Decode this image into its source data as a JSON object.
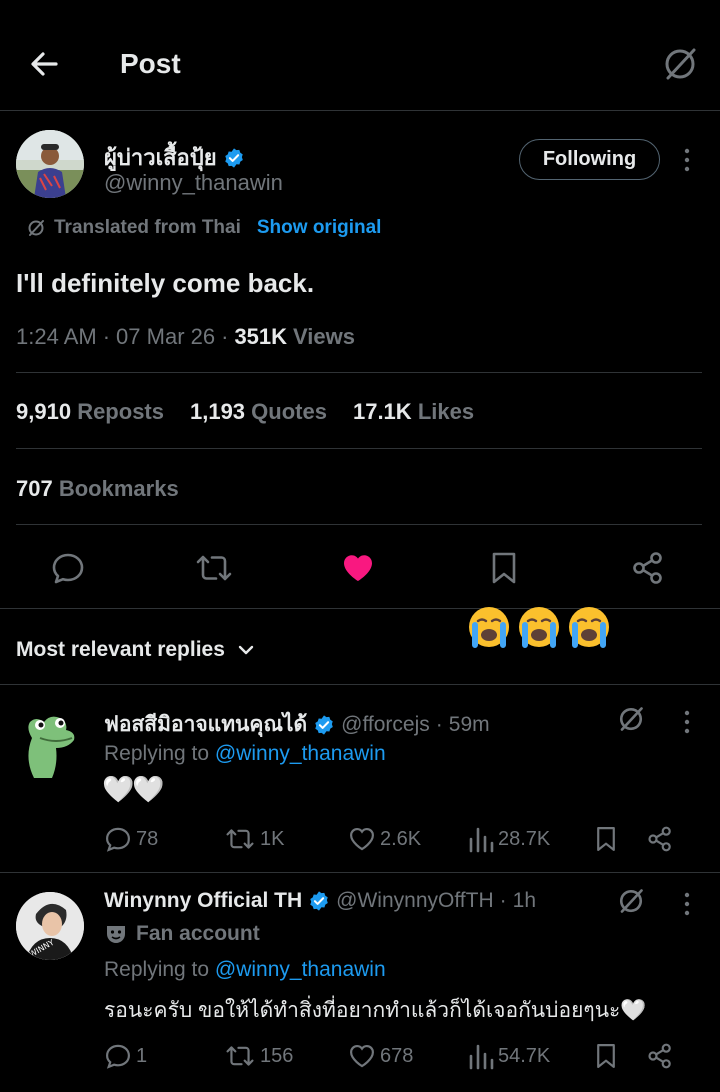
{
  "header": {
    "title": "Post"
  },
  "post": {
    "author_name": "ผู้บ่าวเสื้อปุ้ย",
    "handle": "@winny_thanawin",
    "follow_label": "Following",
    "translated_label": "Translated from Thai",
    "show_original_label": "Show original",
    "text": "I'll definitely come back.",
    "time": "1:24 AM",
    "date": "07 Mar 26",
    "views_count": "351K",
    "views_label": "Views",
    "reposts_count": "9,910",
    "reposts_label": "Reposts",
    "quotes_count": "1,193",
    "quotes_label": "Quotes",
    "likes_count": "17.1K",
    "likes_label": "Likes",
    "bookmarks_count": "707",
    "bookmarks_label": "Bookmarks",
    "liked": true,
    "like_color": "#f91880"
  },
  "replies_header": {
    "label": "Most relevant replies"
  },
  "replies": [
    {
      "name": "ฟอสสีมิอาจแทนคุณได้",
      "handle": "@fforcejs",
      "time": "59m",
      "replying_prefix": "Replying to",
      "replying_to": "@winny_thanawin",
      "text": "🤍🤍",
      "replies": "78",
      "reposts": "1K",
      "likes": "2.6K",
      "views": "28.7K"
    },
    {
      "name": "Winynny Official TH",
      "handle": "@WinynnyOffTH",
      "time": "1h",
      "badge": "Fan account",
      "replying_prefix": "Replying to",
      "replying_to": "@winny_thanawin",
      "text": "รอนะครับ ขอให้ได้ทำสิ่งที่อยากทำแล้วก็ได้เจอกันบ่อยๆนะ🤍",
      "replies": "1",
      "reposts": "156",
      "likes": "678",
      "views": "54.7K"
    }
  ],
  "colors": {
    "accent": "#1d9bf0",
    "background": "#000000",
    "muted": "#71767b",
    "like": "#f91880"
  },
  "icons": [
    "back-arrow-icon",
    "grok-icon",
    "verified-icon",
    "more-icon",
    "reply-icon",
    "repost-icon",
    "like-icon",
    "bookmark-icon",
    "share-icon",
    "views-icon",
    "chevron-down-icon",
    "crying-emoji-icon",
    "theater-mask-icon"
  ]
}
